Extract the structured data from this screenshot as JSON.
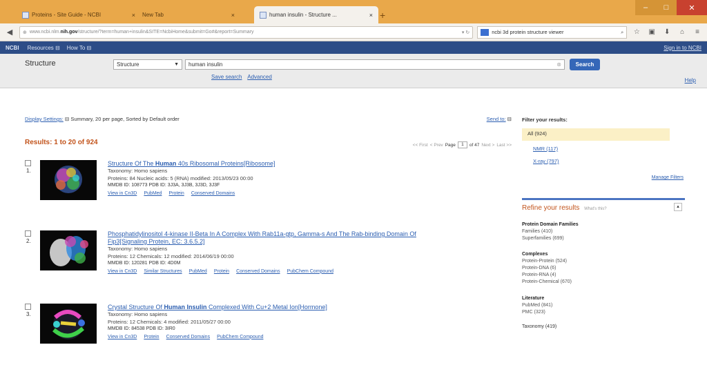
{
  "browser": {
    "tabs": [
      {
        "label": "Proteins - Site Guide - NCBI"
      },
      {
        "label": "New Tab"
      },
      {
        "label": "human insulin - Structure ..."
      }
    ],
    "url_prefix": "www.ncbi.nlm.",
    "url_domain": "nih.gov",
    "url_rest": "/structure/?term=human+insulin&SITE=NcbiHome&submit=Go#&report=Summary",
    "search_value": "ncbi 3d protein structure viewer"
  },
  "ncbi": {
    "logo": "NCBI",
    "resources": "Resources",
    "howto": "How To",
    "signin": "Sign in to NCBI"
  },
  "search": {
    "db_title": "Structure",
    "db_selected": "Structure",
    "term": "human insulin",
    "button": "Search",
    "save_search": "Save search",
    "advanced": "Advanced",
    "help": "Help"
  },
  "display": {
    "settings_link": "Display Settings:",
    "settings_text": "Summary, 20 per page, Sorted by Default order",
    "send_to": "Send to:"
  },
  "results": {
    "summary": "Results: 1 to 20 of 924",
    "pager": {
      "first": "<< First",
      "prev": "< Prev",
      "page_label": "Page",
      "page": "1",
      "of": "of 47",
      "next": "Next >",
      "last": "Last >>"
    },
    "items": [
      {
        "num": "1.",
        "title_pre": "Structure Of The ",
        "title_bold": "Human",
        "title_post": " 40s Ribosomal Proteins[Ribosome]",
        "title_line2": "",
        "taxonomy": "Taxonomy: Homo sapiens",
        "details": "Proteins: 84  Nucleic acids: 5 (RNA)  modified: 2013/05/23 00:00",
        "ids": "MMDB ID: 108773  PDB ID: 3J3A, 3J3B, 3J3D, 3J3F",
        "links": [
          "View in Cn3D",
          "PubMed",
          "Protein",
          "Conserved Domains"
        ]
      },
      {
        "num": "2.",
        "title_pre": "Phosphatidylinositol 4-kinase II-Beta In A Complex With Rab11a-gtp, Gamma-s And The Rab-binding Domain Of",
        "title_bold": "",
        "title_post": "",
        "title_line2": "Fip3[Signaling Protein, EC: 3.6.5.2]",
        "taxonomy": "Taxonomy: Homo sapiens",
        "details": "Proteins: 12  Chemicals: 12  modified: 2014/06/19 00:00",
        "ids": "MMDB ID: 120281  PDB ID: 4D0M",
        "links": [
          "View in Cn3D",
          "Similar Structures",
          "PubMed",
          "Protein",
          "Conserved Domains",
          "PubChem Compound"
        ]
      },
      {
        "num": "3.",
        "title_pre": "Crystal Structure Of ",
        "title_bold": "Human Insulin",
        "title_post": " Complexed With Cu+2 Metal Ion[Hormone]",
        "title_line2": "",
        "taxonomy": "Taxonomy: Homo sapiens",
        "details": "Proteins: 12  Chemicals: 4  modified: 2011/05/27 00:00",
        "ids": "MMDB ID: 84538  PDB ID: 3IR0",
        "links": [
          "View in Cn3D",
          "Protein",
          "Conserved Domains",
          "PubChem Compound"
        ]
      }
    ]
  },
  "sidebar": {
    "filter_head": "Filter your results:",
    "all": "All (924)",
    "filters": [
      "NMR (117)",
      "X-ray (797)"
    ],
    "manage": "Manage Filters",
    "refine_title": "Refine your results",
    "refine_hint": "What's this?",
    "groups": [
      {
        "name": "Protein Domain Families",
        "items": [
          "Families (410)",
          "Superfamilies (699)"
        ]
      },
      {
        "name": "Complexes",
        "items": [
          "Protein-Protein (524)",
          "Protein-DNA (6)",
          "Protein-RNA (4)",
          "Protein-Chemical (670)"
        ]
      },
      {
        "name": "Literature",
        "items": [
          "PubMed (841)",
          "PMC (323)"
        ]
      },
      {
        "name": "Taxonomy (419)",
        "items": []
      }
    ]
  },
  "colors": {
    "accent": "#2d4d87",
    "results": "#c2531b",
    "tab_bar": "#e9a84a",
    "search_button": "#3567b8",
    "filter_highlight": "#fbf0c6"
  }
}
